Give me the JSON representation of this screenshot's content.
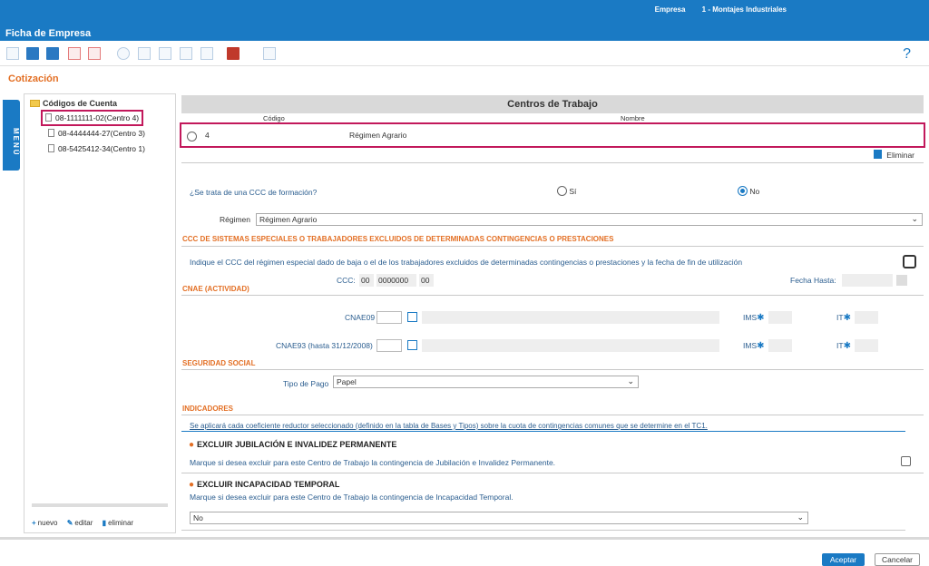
{
  "header": {
    "title": "Ficha de Empresa",
    "empresa_label": "Empresa",
    "empresa_value": "1 - Montajes Industriales",
    "help": "?"
  },
  "section_title": "Cotización",
  "menu_tab": "MENÚ",
  "tree": {
    "root": "Códigos de Cuenta",
    "items": [
      {
        "label": "08-1111111-02(Centro 4)"
      },
      {
        "label": "08-4444444-27(Centro 3)"
      },
      {
        "label": "08-5425412-34(Centro 1)"
      }
    ],
    "footer": {
      "new": "nuevo",
      "edit": "editar",
      "delete": "eliminar"
    }
  },
  "centros": {
    "title": "Centros de Trabajo",
    "col_code": "Código",
    "col_name": "Nombre",
    "row": {
      "code": "4",
      "name": "Régimen Agrario"
    },
    "delete": "Eliminar"
  },
  "formacion": {
    "question": "¿Se trata de una CCC de formación?",
    "yes": "Sí",
    "no": "No",
    "selected": "No"
  },
  "regimen": {
    "label": "Régimen",
    "value": "Régimen Agrario"
  },
  "ccc_especiales": {
    "heading": "CCC DE SISTEMAS ESPECIALES O TRABAJADORES EXCLUIDOS DE DETERMINADAS CONTINGENCIAS O PRESTACIONES",
    "description": "Indique el CCC del régimen especial dado de baja o el de los trabajadores excluidos de determinadas contingencias o prestaciones y la fecha de fin de utilización",
    "ccc_label": "CCC:",
    "ccc_p1": "00",
    "ccc_p2": "0000000",
    "ccc_p3": "00",
    "fecha_hasta": "Fecha Hasta:"
  },
  "cnae": {
    "heading": "CNAE (ACTIVIDAD)",
    "cnae09": "CNAE09",
    "cnae93": "CNAE93 (hasta 31/12/2008)",
    "ims": "IMS",
    "it": "IT"
  },
  "seguridad_social": {
    "heading": "SEGURIDAD SOCIAL",
    "tipo_pago_label": "Tipo de Pago",
    "tipo_pago_value": "Papel"
  },
  "indicadores": {
    "heading": "INDICADORES",
    "note": "Se aplicará cada coeficiente reductor seleccionado (definido en la tabla de Bases y Tipos) sobre la cuota de contingencias comunes que se determine en el TC1.",
    "jubilacion_title": "EXCLUIR JUBILACIÓN E INVALIDEZ PERMANENTE",
    "jubilacion_desc": "Marque si desea excluir para este Centro de Trabajo la contingencia de Jubilación e Invalidez Permanente.",
    "it_title": "EXCLUIR INCAPACIDAD TEMPORAL",
    "it_desc": "Marque si desea excluir para este Centro de Trabajo la contingencia de Incapacidad Temporal.",
    "it_select": "No"
  },
  "footer": {
    "accept": "Aceptar",
    "cancel": "Cancelar"
  }
}
